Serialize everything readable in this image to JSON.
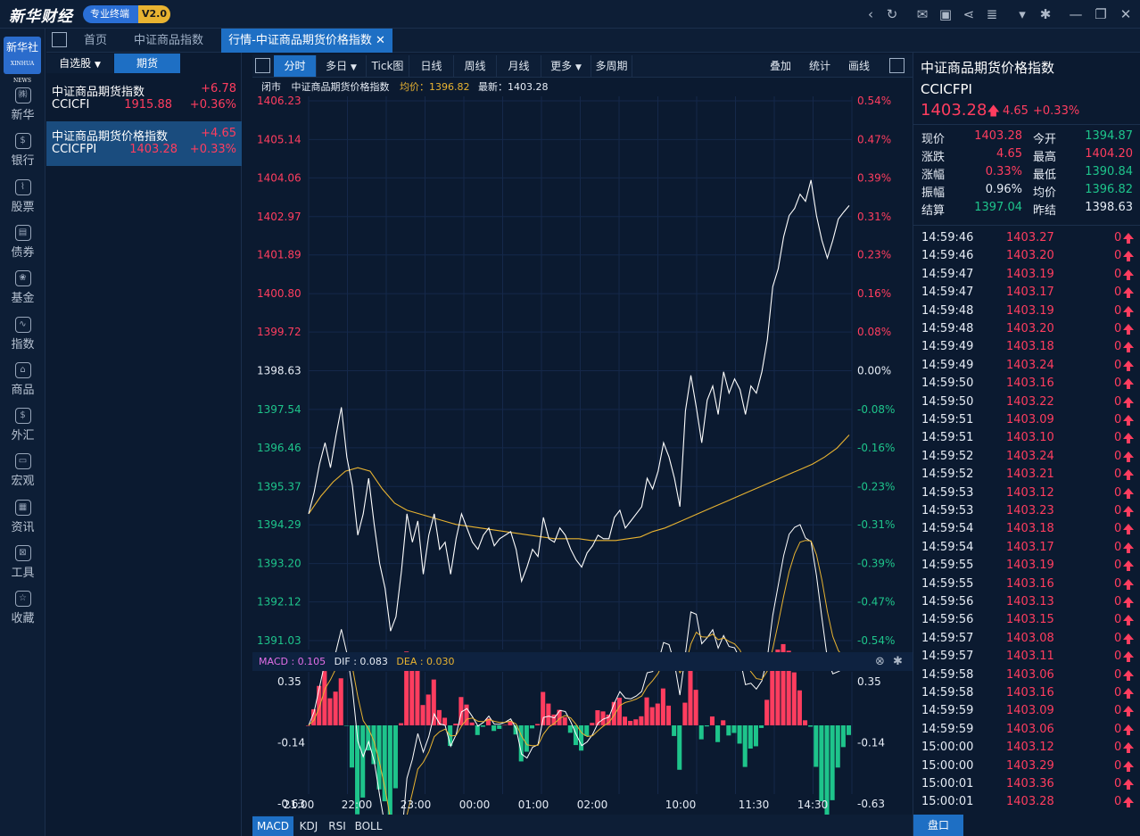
{
  "app": {
    "brand": "新华财经",
    "badge": "专业终端",
    "version": "V2.0"
  },
  "sidebar": {
    "logo": "新华社",
    "items": [
      "新华",
      "银行",
      "股票",
      "债券",
      "基金",
      "指数",
      "商品",
      "外汇",
      "宏观",
      "资讯",
      "工具",
      "收藏"
    ]
  },
  "tabs": {
    "home": "首页",
    "tab2": "中证商品指数",
    "tab3": "行情-中证商品期货价格指数"
  },
  "watchlist": {
    "tab_self": "自选股",
    "tab_futures": "期货",
    "items": [
      {
        "name": "中证商品期货指数",
        "change": "+6.78",
        "code": "CCICFI",
        "price": "1915.88",
        "pct": "+0.36%"
      },
      {
        "name": "中证商品期货价格指数",
        "change": "+4.65",
        "code": "CCICFPI",
        "price": "1403.28",
        "pct": "+0.33%"
      }
    ]
  },
  "chart_toolbar": {
    "items": [
      "分时",
      "多日",
      "Tick图",
      "日线",
      "周线",
      "月线",
      "更多",
      "多周期"
    ],
    "right": [
      "叠加",
      "统计",
      "画线"
    ]
  },
  "info": {
    "status": "闭市",
    "name": "中证商品期货价格指数",
    "avg_label": "均价：",
    "avg": "1396.82",
    "last_label": "最新：",
    "last": "1403.28"
  },
  "chart_data": {
    "type": "line",
    "series": [],
    "ylim": [
      1391.03,
      1406.23
    ],
    "prev_close": 1398.63,
    "y_ticks": [
      "1406.23",
      "1405.14",
      "1404.06",
      "1402.97",
      "1401.89",
      "1400.80",
      "1399.72",
      "1398.63",
      "1397.54",
      "1396.46",
      "1395.37",
      "1394.29",
      "1393.20",
      "1392.12",
      "1391.03"
    ],
    "pct_ticks": [
      "0.54%",
      "0.47%",
      "0.39%",
      "0.31%",
      "0.23%",
      "0.16%",
      "0.08%",
      "0.00%",
      "-0.08%",
      "-0.16%",
      "-0.23%",
      "-0.31%",
      "-0.39%",
      "-0.47%",
      "-0.54%"
    ],
    "x_ticks": [
      "21:00",
      "22:00",
      "23:00",
      "00:00",
      "01:00",
      "02:00",
      "10:00",
      "11:30",
      "14:30"
    ],
    "price": [
      1394.6,
      1395.2,
      1396.0,
      1396.6,
      1395.9,
      1396.8,
      1397.6,
      1396.2,
      1395.4,
      1394.0,
      1394.6,
      1395.6,
      1394.3,
      1393.2,
      1392.5,
      1391.3,
      1391.7,
      1393.0,
      1394.6,
      1393.8,
      1394.4,
      1392.9,
      1394.0,
      1394.6,
      1393.6,
      1393.8,
      1392.9,
      1393.9,
      1394.6,
      1394.2,
      1393.8,
      1393.6,
      1394.0,
      1394.2,
      1393.7,
      1393.9,
      1394.0,
      1394.1,
      1393.6,
      1392.7,
      1393.1,
      1393.6,
      1393.4,
      1394.5,
      1393.9,
      1393.8,
      1394.2,
      1394.0,
      1393.6,
      1393.3,
      1393.1,
      1393.5,
      1393.7,
      1394.0,
      1393.9,
      1393.9,
      1394.5,
      1394.7,
      1394.2,
      1394.4,
      1394.6,
      1394.8,
      1395.6,
      1395.3,
      1395.8,
      1396.6,
      1396.2,
      1395.6,
      1394.8,
      1397.5,
      1398.5,
      1397.6,
      1396.6,
      1397.8,
      1398.2,
      1397.4,
      1398.6,
      1398.0,
      1398.4,
      1398.1,
      1397.4,
      1398.2,
      1398.0,
      1398.6,
      1399.5,
      1401.0,
      1401.5,
      1402.4,
      1403.0,
      1403.2,
      1403.6,
      1403.4,
      1404.0,
      1403.0,
      1402.3,
      1401.8,
      1402.3,
      1402.9,
      1403.1,
      1403.28
    ],
    "avg": [
      1394.6,
      1395.1,
      1395.5,
      1395.8,
      1395.9,
      1395.8,
      1395.3,
      1394.9,
      1394.7,
      1394.6,
      1394.5,
      1394.4,
      1394.3,
      1394.25,
      1394.2,
      1394.15,
      1394.1,
      1394.05,
      1394.0,
      1393.95,
      1393.9,
      1393.9,
      1393.9,
      1393.85,
      1393.85,
      1393.85,
      1393.9,
      1393.95,
      1394.1,
      1394.2,
      1394.35,
      1394.5,
      1394.65,
      1394.8,
      1394.95,
      1395.1,
      1395.25,
      1395.4,
      1395.55,
      1395.7,
      1395.85,
      1396.0,
      1396.2,
      1396.45,
      1396.82
    ],
    "macd": {
      "label": "MACD : 0.105",
      "dif": "DIF : 0.083",
      "dea": "DEA : 0.030",
      "y_ticks": [
        "0.35",
        "-0.14",
        "-0.63"
      ]
    }
  },
  "bottom_tabs": [
    "MACD",
    "KDJ",
    "RSI",
    "BOLL"
  ],
  "quote": {
    "name": "中证商品期货价格指数",
    "code": "CCICFPI",
    "price": "1403.28",
    "change": "4.65",
    "pct": "+0.33%",
    "stats": [
      [
        "现价",
        "1403.28",
        "今开",
        "1394.87"
      ],
      [
        "涨跌",
        "4.65",
        "最高",
        "1404.20"
      ],
      [
        "涨幅",
        "0.33%",
        "最低",
        "1390.84"
      ],
      [
        "振幅",
        "0.96%",
        "均价",
        "1396.82"
      ],
      [
        "结算",
        "1397.04",
        "昨结",
        "1398.63"
      ]
    ],
    "ticks": [
      [
        "14:59:46",
        "1403.27"
      ],
      [
        "14:59:46",
        "1403.20"
      ],
      [
        "14:59:47",
        "1403.19"
      ],
      [
        "14:59:47",
        "1403.17"
      ],
      [
        "14:59:48",
        "1403.19"
      ],
      [
        "14:59:48",
        "1403.20"
      ],
      [
        "14:59:49",
        "1403.18"
      ],
      [
        "14:59:49",
        "1403.24"
      ],
      [
        "14:59:50",
        "1403.16"
      ],
      [
        "14:59:50",
        "1403.22"
      ],
      [
        "14:59:51",
        "1403.09"
      ],
      [
        "14:59:51",
        "1403.10"
      ],
      [
        "14:59:52",
        "1403.24"
      ],
      [
        "14:59:52",
        "1403.21"
      ],
      [
        "14:59:53",
        "1403.12"
      ],
      [
        "14:59:53",
        "1403.23"
      ],
      [
        "14:59:54",
        "1403.18"
      ],
      [
        "14:59:54",
        "1403.17"
      ],
      [
        "14:59:55",
        "1403.19"
      ],
      [
        "14:59:55",
        "1403.16"
      ],
      [
        "14:59:56",
        "1403.13"
      ],
      [
        "14:59:56",
        "1403.15"
      ],
      [
        "14:59:57",
        "1403.08"
      ],
      [
        "14:59:57",
        "1403.11"
      ],
      [
        "14:59:58",
        "1403.06"
      ],
      [
        "14:59:58",
        "1403.16"
      ],
      [
        "14:59:59",
        "1403.09"
      ],
      [
        "14:59:59",
        "1403.06"
      ],
      [
        "15:00:00",
        "1403.12"
      ],
      [
        "15:00:00",
        "1403.29"
      ],
      [
        "15:00:01",
        "1403.36"
      ],
      [
        "15:00:01",
        "1403.28"
      ]
    ],
    "tick_vol": "0",
    "tab": "盘口"
  }
}
